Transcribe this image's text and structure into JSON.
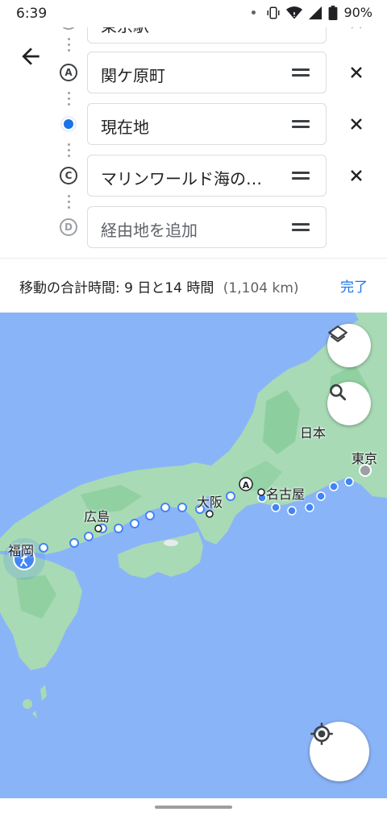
{
  "status_bar": {
    "time": "6:39",
    "battery": "90%"
  },
  "stops": [
    {
      "marker": "",
      "value": "東京駅",
      "placeholder": false,
      "removable": true
    },
    {
      "marker": "A",
      "value": "関ケ原町",
      "placeholder": false,
      "removable": true
    },
    {
      "marker": "",
      "value": "現在地",
      "placeholder": false,
      "removable": true
    },
    {
      "marker": "C",
      "value": "マリンワールド海の…",
      "placeholder": false,
      "removable": true
    },
    {
      "marker": "D",
      "value": "経由地を追加",
      "placeholder": true,
      "removable": false
    }
  ],
  "summary": {
    "text": "移動の合計時間: 9 日と14 時間",
    "distance": "(1,104 km)",
    "done_label": "完了"
  },
  "map": {
    "labels": {
      "japan": "日本",
      "tokyo": "東京",
      "nagoya": "名古屋",
      "osaka": "大阪",
      "hiroshima": "広島",
      "fukuoka": "福岡"
    },
    "route_marker": "A"
  },
  "colors": {
    "accent": "#1a73e8",
    "water": "#8ab4f8",
    "land": "#a8dab5",
    "land_dark": "#81c995"
  },
  "icons": {
    "back": "arrow-back-icon",
    "layers": "layers-icon",
    "search": "search-icon",
    "location": "my-location-icon",
    "walking": "walking-icon"
  }
}
